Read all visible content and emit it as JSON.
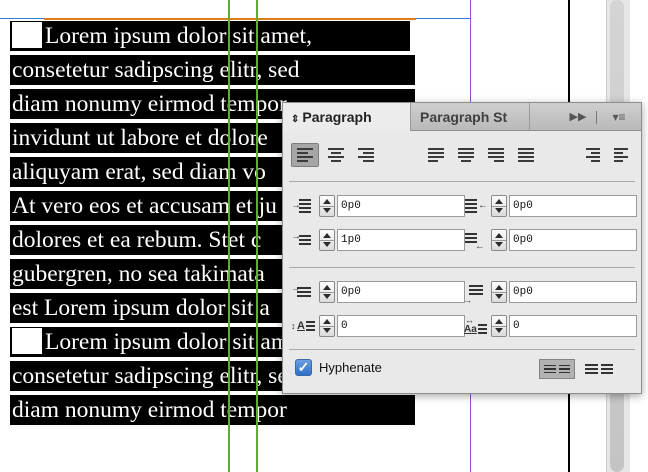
{
  "document": {
    "lines": [
      "Lorem ipsum dolor sit amet,",
      "consetetur sadipscing elitr, sed",
      "diam nonumy eirmod tempor",
      "invidunt ut labore et dolore",
      "aliquyam erat, sed diam vo",
      "At vero eos et accusam et ju",
      "dolores et ea rebum. Stet c",
      "gubergren, no sea takimata",
      "est Lorem ipsum dolor sit a",
      "Lorem ipsum dolor sit amet,",
      "consetetur sadipscing elitr, sed",
      "diam nonumy eirmod tempor"
    ]
  },
  "panel": {
    "tab_active": "Paragraph",
    "tab_inactive": "Paragraph St",
    "tab_active_icon": "collapse-arrows-icon",
    "overflow_icon": "double-chevron-right-icon",
    "menu_icon": "panel-menu-icon",
    "alignment_buttons": [
      "align-left-icon",
      "align-center-icon",
      "align-right-icon",
      "justify-left-icon",
      "justify-center-icon",
      "justify-right-icon",
      "justify-all-icon",
      "align-towards-spine-icon",
      "align-away-from-spine-icon"
    ],
    "left_indent": "0p0",
    "right_indent": "0p0",
    "first_line_indent": "1p0",
    "last_line_right_indent": "0p0",
    "space_before": "0p0",
    "space_after": "0p0",
    "drop_cap_lines": "0",
    "drop_cap_characters": "0",
    "hyphenate_label": "Hyphenate",
    "hyphenate_checked": true
  },
  "colors": {
    "text_highlight": "#000000",
    "column_guide": "#5fae2f",
    "margin_guide": "#9a4fd0",
    "checkbox_accent": "#2f6fc7"
  }
}
